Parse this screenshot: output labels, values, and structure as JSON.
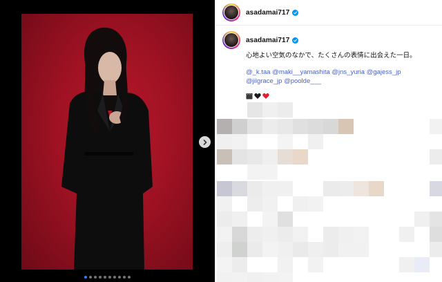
{
  "post": {
    "username": "asadamai717",
    "caption": "心地よい空気のなかで、たくさんの表情に出会えた一日。",
    "mentions": [
      "@_k.taa",
      "@maki__yamashita",
      "@jns_yuria",
      "@gajess_jp",
      "@jilgrace_jp",
      "@poolde___"
    ],
    "emojis": [
      "clapper-board-icon",
      "black-heart-icon",
      "red-heart-icon"
    ]
  },
  "carousel": {
    "total_slides": 10,
    "active_slide": 1
  },
  "colors": {
    "accent": "#2f7cf6",
    "mention": "#4b63c9",
    "backdrop": "#9e1223"
  }
}
